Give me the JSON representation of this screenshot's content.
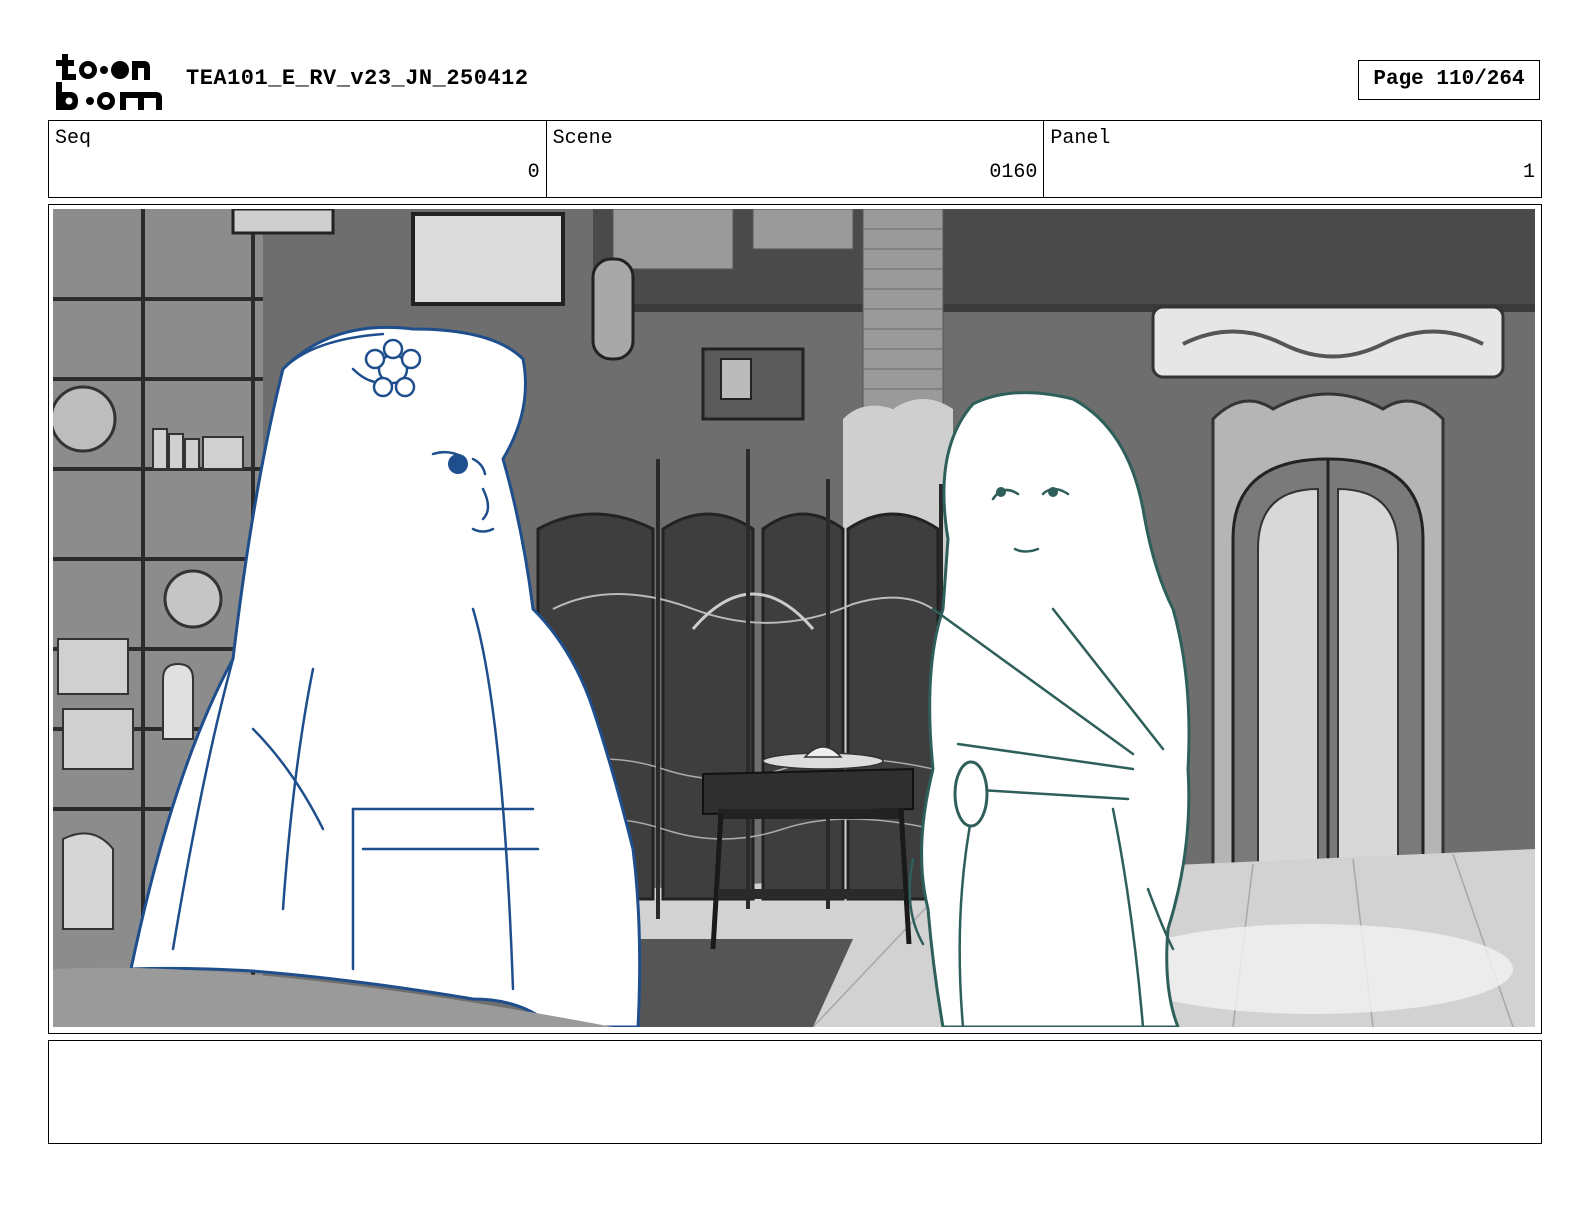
{
  "header": {
    "logo_alt": "toon boom",
    "doc_title": "TEA101_E_RV_v23_JN_250412",
    "page_label": "Page 110/264"
  },
  "info": {
    "seq_label": "Seq",
    "seq_value": "0",
    "scene_label": "Scene",
    "scene_value": "0160",
    "panel_label": "Panel",
    "panel_value": "1"
  },
  "panel_image": {
    "icon": "storyboard-sketch",
    "scene_colors": {
      "left_character_line": "#1f4e8c",
      "right_character_line": "#2f5f5a",
      "background_dark": "#4a4a4a",
      "background_mid": "#8a8a8a"
    }
  },
  "notes": {
    "text": ""
  }
}
